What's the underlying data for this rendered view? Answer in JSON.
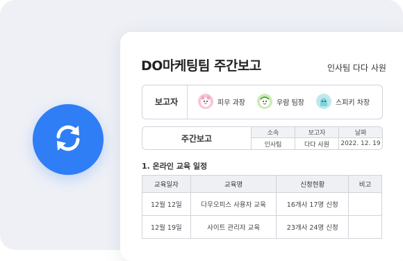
{
  "document": {
    "title": "DO마케팅팀 주간보고",
    "author": "인사팀 다다 사원"
  },
  "reporters": {
    "label": "보고자",
    "people": [
      {
        "name": "피우 과장",
        "avatar_color": "#f7c6d6"
      },
      {
        "name": "우람 팀장",
        "avatar_color": "#cdebb5"
      },
      {
        "name": "스피키 차장",
        "avatar_color": "#bfe8ec"
      }
    ]
  },
  "weekly_report": {
    "title": "주간보고",
    "headers": [
      "소속",
      "보고자",
      "날짜"
    ],
    "values": [
      "인사팀",
      "다다 사원",
      "2022. 12. 19"
    ]
  },
  "section": {
    "title": "1. 온라인 교육 일정"
  },
  "schedule": {
    "headers": [
      "교육일자",
      "교육명",
      "신청현황",
      "비고"
    ],
    "rows": [
      [
        "12월 12일",
        "다우오피스 사용자 교육",
        "16개사 17명 신청",
        ""
      ],
      [
        "12월 19일",
        "사이트 관리자 교육",
        "23개사 24명 신청",
        ""
      ]
    ]
  },
  "colors": {
    "accent": "#2f7ef5",
    "background": "#eef0f6"
  },
  "icons": {
    "sync": "sync-icon"
  }
}
